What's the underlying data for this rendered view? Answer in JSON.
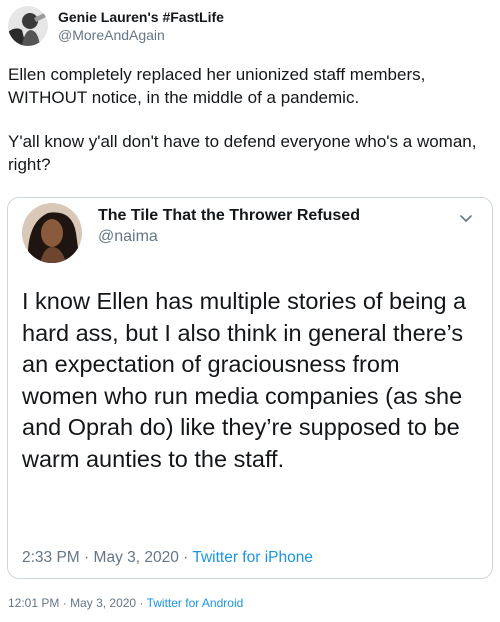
{
  "tweet": {
    "author": {
      "display_name": "Genie Lauren's #FastLife",
      "handle": "@MoreAndAgain"
    },
    "paragraphs": [
      "Ellen completely replaced her unionized staff members, WITHOUT notice, in the middle of a pandemic.",
      "Y'all know y'all don't have to defend everyone who's a woman, right?"
    ],
    "time": "12:01 PM",
    "sep": "·",
    "date": "May 3, 2020",
    "source": "Twitter for Android"
  },
  "quoted": {
    "author": {
      "display_name": "The Tile That the Thrower Refused",
      "handle": "@naima"
    },
    "text": "I know Ellen has multiple stories of being a hard ass, but I also think in general there’s an expectation of graciousness from women who run media companies (as she and Oprah do) like they’re supposed to be warm aunties to the staff.",
    "time": "2:33 PM",
    "sep": "·",
    "date": "May 3, 2020",
    "source": "Twitter for iPhone"
  },
  "colors": {
    "secondary_text": "#657786",
    "link": "#1b95e0",
    "border": "#ccd6dd"
  },
  "icons": {
    "more": "chevron-down-icon"
  }
}
